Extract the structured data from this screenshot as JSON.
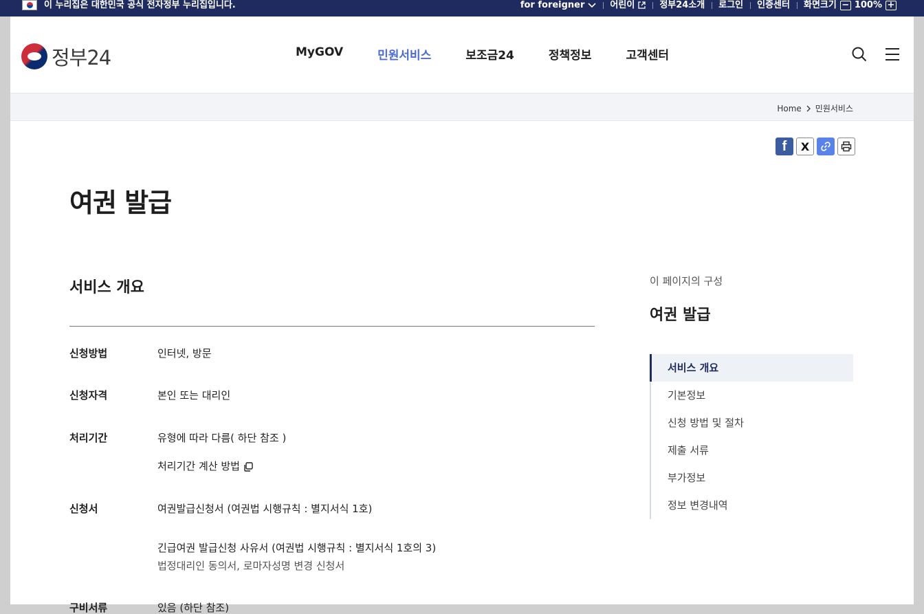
{
  "topbar": {
    "notice": "이 누리집은 대한민국 공식 전자정부 누리집입니다.",
    "foreigner": "for foreigner",
    "kids": "어린이",
    "about": "정부24소개",
    "login": "로그인",
    "cert": "인증센터",
    "zoom_label": "화면크기",
    "zoom_minus": "−",
    "zoom_value": "100%",
    "zoom_plus": "+"
  },
  "header": {
    "logo_text": "정부24",
    "nav": [
      "MyGOV",
      "민원서비스",
      "보조금24",
      "정책정보",
      "고객센터"
    ],
    "active_nav": "민원서비스"
  },
  "breadcrumb": {
    "home": "Home",
    "current": "민원서비스"
  },
  "share": {
    "facebook": "f",
    "x": "X"
  },
  "page": {
    "title": "여권 발급"
  },
  "overview": {
    "title": "서비스 개요",
    "method_label": "신청방법",
    "method_value": "인터넷, 방문",
    "eligibility_label": "신청자격",
    "eligibility_value": "본인 또는 대리인",
    "period_label": "처리기간",
    "period_value": "유형에 따라 다름( 하단 참조 )",
    "period_link": "처리기간 계산 방법",
    "form_label": "신청서",
    "form_value_1": "여권발급신청서 (여권법 시행규칙 : 별지서식 1호)",
    "form_value_2": "긴급여권 발급신청 사유서 (여권법 시행규칙 : 별지서식 1호의 3)",
    "form_value_3": "법정대리인 동의서, 로마자성명 변경 신청서",
    "docs_label": "구비서류",
    "docs_value": "있음 (하단 참조)"
  },
  "toc": {
    "caption": "이 페이지의 구성",
    "title": "여권 발급",
    "items": [
      "서비스 개요",
      "기본정보",
      "신청 방법 및 절차",
      "제출 서류",
      "부가정보",
      "정보 변경내역"
    ]
  }
}
